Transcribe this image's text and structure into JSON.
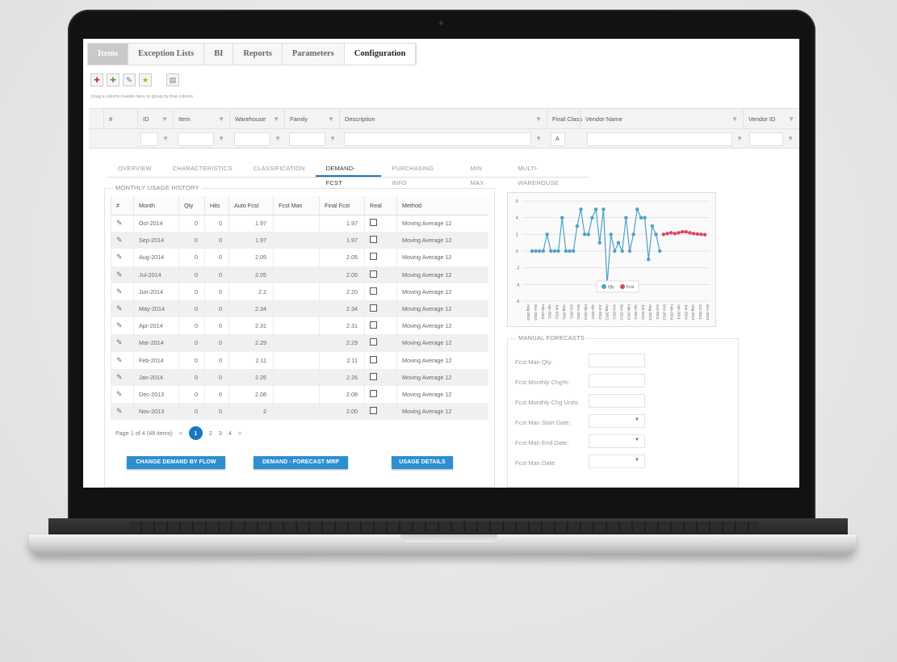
{
  "top_tabs": [
    "Items",
    "Exception Lists",
    "BI",
    "Reports",
    "Parameters",
    "Configuration"
  ],
  "toolbar_icons": [
    "add-red-icon",
    "add-green-icon",
    "edit-blue-icon",
    "star-yellow-icon",
    "export-icon"
  ],
  "drag_hint": "Drag a column header here to group by that column",
  "grid_columns": {
    "num": "#",
    "id": "ID",
    "item": "Item",
    "warehouse": "Warehouse",
    "family": "Family",
    "description": "Description",
    "final_class": "Final Class",
    "vendor_name": "Vendor Name",
    "vendor_id": "Vendor ID"
  },
  "filter_values": {
    "final_class": "A"
  },
  "sub_tabs": [
    "OVERVIEW",
    "CHARACTERISTICS",
    "CLASSIFICATION",
    "DEMAND-FCST",
    "PURCHASING INFO",
    "MIN MAX",
    "MULTI-WAREHOUSE"
  ],
  "active_sub_tab": "DEMAND-FCST",
  "usage": {
    "title": "MONTHLY USAGE HISTORY",
    "headers": [
      "#",
      "Month",
      "Qty",
      "Hits",
      "Auto Fcst",
      "Fcst Man",
      "Final Fcst",
      "Real",
      "Method"
    ],
    "rows": [
      {
        "month": "Oct-2014",
        "qty": "0",
        "hits": "0",
        "auto": "1.97",
        "man": "",
        "final": "1.97",
        "method": "Moving Average 12"
      },
      {
        "month": "Sep-2014",
        "qty": "0",
        "hits": "0",
        "auto": "1.97",
        "man": "",
        "final": "1.97",
        "method": "Moving Average 12"
      },
      {
        "month": "Aug-2014",
        "qty": "0",
        "hits": "0",
        "auto": "2.05",
        "man": "",
        "final": "2.05",
        "method": "Moving Average 12"
      },
      {
        "month": "Jul-2014",
        "qty": "0",
        "hits": "0",
        "auto": "2.05",
        "man": "",
        "final": "2.05",
        "method": "Moving Average 12"
      },
      {
        "month": "Jun-2014",
        "qty": "0",
        "hits": "0",
        "auto": "2.2",
        "man": "",
        "final": "2.20",
        "method": "Moving Average 12"
      },
      {
        "month": "May-2014",
        "qty": "0",
        "hits": "0",
        "auto": "2.34",
        "man": "",
        "final": "2.34",
        "method": "Moving Average 12"
      },
      {
        "month": "Apr-2014",
        "qty": "0",
        "hits": "0",
        "auto": "2.31",
        "man": "",
        "final": "2.31",
        "method": "Moving Average 12"
      },
      {
        "month": "Mar-2014",
        "qty": "0",
        "hits": "0",
        "auto": "2.29",
        "man": "",
        "final": "2.29",
        "method": "Moving Average 12"
      },
      {
        "month": "Feb-2014",
        "qty": "0",
        "hits": "0",
        "auto": "2.11",
        "man": "",
        "final": "2.11",
        "method": "Moving Average 12"
      },
      {
        "month": "Jan-2014",
        "qty": "0",
        "hits": "0",
        "auto": "2.26",
        "man": "",
        "final": "2.26",
        "method": "Moving Average 12"
      },
      {
        "month": "Dec-2013",
        "qty": "0",
        "hits": "0",
        "auto": "2.08",
        "man": "",
        "final": "2.08",
        "method": "Moving Average 12"
      },
      {
        "month": "Nov-2013",
        "qty": "0",
        "hits": "0",
        "auto": "2",
        "man": "",
        "final": "2.00",
        "method": "Moving Average 12"
      }
    ],
    "pager": {
      "summary": "Page 1 of 4 (48 items)",
      "prev": "<",
      "pages": [
        "1",
        "2",
        "3",
        "4"
      ],
      "current": "1",
      "next": ">"
    }
  },
  "buttons": {
    "change_demand": "CHANGE DEMAND BY FLOW",
    "demand_forecast": "DEMAND - FORECAST MRP",
    "usage_details": "USAGE DETAILS"
  },
  "chart_data": {
    "type": "line",
    "y_ticks": [
      "6",
      "4",
      "2",
      "0",
      "-2",
      "-4",
      "-6"
    ],
    "ylim": [
      -6,
      6
    ],
    "x": [
      "Aug-2010",
      "Dec-2010",
      "Feb-2011",
      "Apr-2011",
      "Jun-2011",
      "Aug-2011",
      "Oct-2011",
      "Dec-2011",
      "Feb-2012",
      "Apr-2012",
      "Jun-2012",
      "Aug-2012",
      "Oct-2012",
      "Dec-2012",
      "Feb-2013",
      "Apr-2013",
      "Jun-2013",
      "Aug-2013",
      "Oct-2013",
      "Dec-2013",
      "Feb-2014",
      "Apr-2014",
      "Jun-2014",
      "Aug-2014",
      "Oct-2014",
      "Dec-2014"
    ],
    "series": [
      {
        "name": "Qty",
        "color": "#4aa3c4",
        "values": [
          0,
          0,
          0,
          0,
          2,
          0,
          0,
          0,
          4,
          0,
          0,
          0,
          3,
          5,
          2,
          2,
          4,
          5,
          1,
          5,
          -4,
          2,
          0,
          1,
          0,
          4,
          0,
          2,
          5,
          4,
          4,
          -1,
          3,
          2,
          0
        ]
      },
      {
        "name": "Fcst",
        "color": "#d9475f",
        "values": [
          2,
          2.1,
          2.2,
          2.1,
          2.2,
          2.3,
          2.3,
          2.2,
          2.1,
          2.05,
          2,
          1.97
        ]
      }
    ],
    "legend": "bottom-center"
  },
  "forecasts": {
    "title": "MANUAL FORECASTS",
    "fields": [
      "Fcst Man Qty:",
      "Fcst Monthly Chg%:",
      "Fcst Monthly Chg Units:",
      "Fcst Man Start Date:",
      "Fcst Man End Date:",
      "Fcst Man Date:"
    ]
  }
}
